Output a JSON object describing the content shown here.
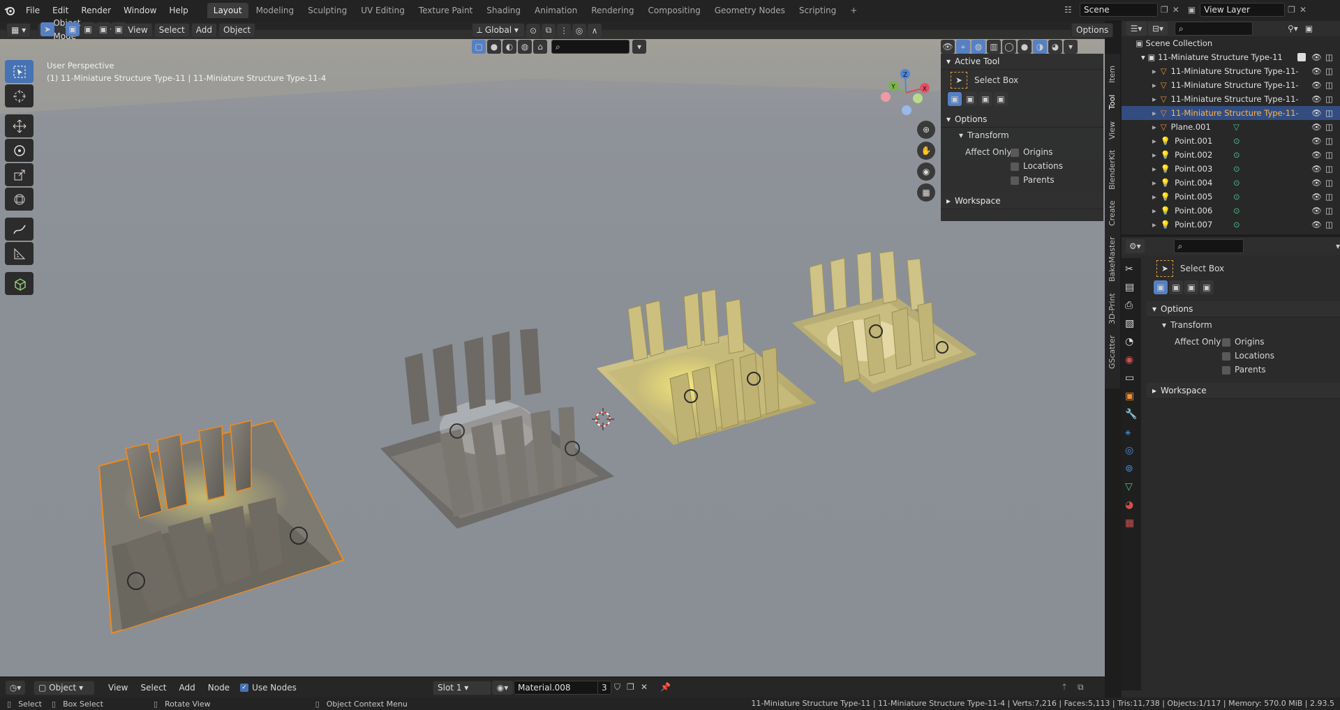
{
  "topbar": {
    "menu": [
      "File",
      "Edit",
      "Render",
      "Window",
      "Help"
    ],
    "workspaces": [
      "Layout",
      "Modeling",
      "Sculpting",
      "UV Editing",
      "Texture Paint",
      "Shading",
      "Animation",
      "Rendering",
      "Compositing",
      "Geometry Nodes",
      "Scripting"
    ],
    "active_workspace": "Layout",
    "add_tab": "+",
    "scene": "Scene",
    "view_layer": "View Layer"
  },
  "vp_header": {
    "mode": "Object Mode",
    "menus": [
      "View",
      "Select",
      "Add",
      "Object"
    ],
    "orientation": "Global",
    "options": "Options"
  },
  "viewport": {
    "perspective": "User Perspective",
    "info": "(1) 11-Miniature Structure Type-11 | 11-Miniature Structure Type-11-4",
    "gizmo": {
      "x": "X",
      "y": "Y",
      "z": "Z"
    }
  },
  "npanel": {
    "active_tool_title": "Active Tool",
    "tool_name": "Select Box",
    "options_title": "Options",
    "transform_title": "Transform",
    "affect_only": "Affect Only",
    "checks": [
      "Origins",
      "Locations",
      "Parents"
    ],
    "workspace_title": "Workspace",
    "tabs": [
      "Item",
      "Tool",
      "View",
      "BlenderKit",
      "Create",
      "BakeMaster",
      "3D-Print",
      "GScatter"
    ]
  },
  "outliner": {
    "root": "Scene Collection",
    "collection": "11-Miniature Structure Type-11",
    "items": [
      {
        "name": "11-Miniature Structure Type-11-",
        "kind": "mesh",
        "selected": false
      },
      {
        "name": "11-Miniature Structure Type-11-",
        "kind": "mesh",
        "selected": false
      },
      {
        "name": "11-Miniature Structure Type-11-",
        "kind": "mesh",
        "selected": false
      },
      {
        "name": "11-Miniature Structure Type-11-",
        "kind": "mesh",
        "selected": true
      },
      {
        "name": "Plane.001",
        "kind": "plane",
        "selected": false
      },
      {
        "name": "Point.001",
        "kind": "light",
        "selected": false
      },
      {
        "name": "Point.002",
        "kind": "light",
        "selected": false
      },
      {
        "name": "Point.003",
        "kind": "light",
        "selected": false
      },
      {
        "name": "Point.004",
        "kind": "light",
        "selected": false
      },
      {
        "name": "Point.005",
        "kind": "light",
        "selected": false
      },
      {
        "name": "Point.006",
        "kind": "light",
        "selected": false
      },
      {
        "name": "Point.007",
        "kind": "light",
        "selected": false
      }
    ]
  },
  "props": {
    "tool_name": "Select Box",
    "options_title": "Options",
    "transform_title": "Transform",
    "affect_only": "Affect Only",
    "checks": [
      "Origins",
      "Locations",
      "Parents"
    ],
    "workspace_title": "Workspace"
  },
  "bottombar": {
    "editor": "Object",
    "menus": [
      "View",
      "Select",
      "Add",
      "Node"
    ],
    "use_nodes": "Use Nodes",
    "slot": "Slot 1",
    "material": "Material.008",
    "users": "3"
  },
  "statusbar": {
    "select": "Select",
    "box_select": "Box Select",
    "rotate_view": "Rotate View",
    "context_menu": "Object Context Menu",
    "stats": "11-Miniature Structure Type-11 | 11-Miniature Structure Type-11-4 | Verts:7,216 | Faces:5,113 | Tris:11,738 | Objects:1/117 | Memory: 570.0 MiB | 2.93.5"
  },
  "colors": {
    "accent": "#4772b3",
    "selection": "#f08a1c",
    "active_highlight": "#ffb54a"
  }
}
